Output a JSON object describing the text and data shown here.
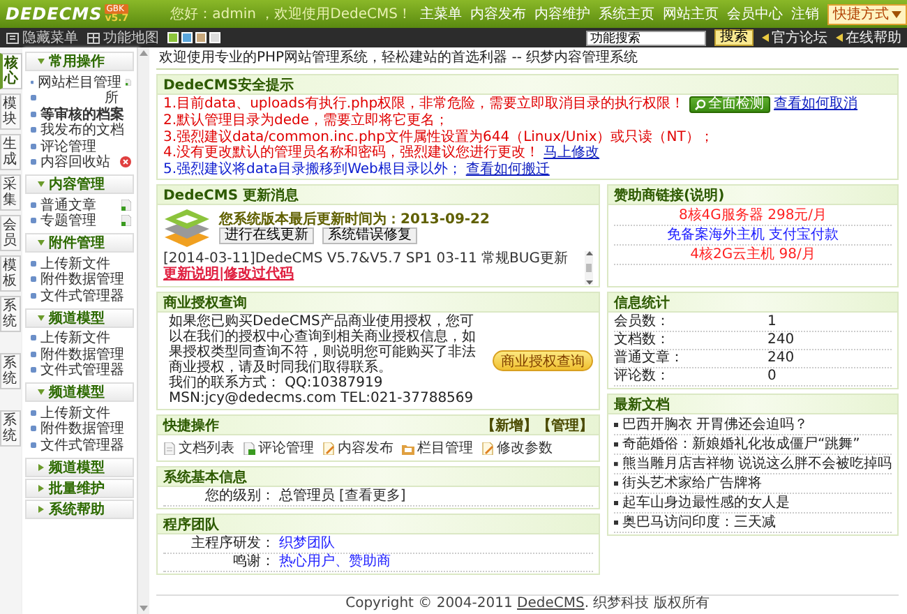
{
  "header": {
    "logo": "DEDECMS",
    "version": "v5.7",
    "edition": "GBK",
    "greeting": "您好：admin ，欢迎使用DedeCMS！",
    "nav": [
      "主菜单",
      "内容发布",
      "内容维护",
      "系统主页",
      "网站主页",
      "会员中心",
      "注销"
    ],
    "shortcut": "快捷方式"
  },
  "toolbar": {
    "buttons": [
      "隐藏菜单",
      "功能地图"
    ],
    "swatches": [
      {
        "color": "#8cc43c"
      },
      {
        "color": "#5aa6dc"
      },
      {
        "color": "#c8a87c"
      },
      {
        "color": "#dcdcdc"
      }
    ],
    "search": {
      "value": "功能搜索",
      "button": "搜索"
    },
    "links": [
      "官方论坛",
      "在线帮助"
    ]
  },
  "side_tabs": [
    {
      "label": "核心",
      "selected": true
    },
    {
      "label": "模块",
      "selected": false
    },
    {
      "label": "生成",
      "selected": false
    },
    {
      "label": "采集",
      "selected": false
    },
    {
      "label": "会员",
      "selected": false
    },
    {
      "label": "模板",
      "selected": false
    },
    {
      "label": "系统",
      "selected": false
    },
    {
      "label": "系统",
      "selected": false
    },
    {
      "label": "系统",
      "selected": false
    }
  ],
  "menu": [
    {
      "title": "常用操作",
      "expanded": true,
      "items": [
        {
          "label": "网站栏目管理",
          "kind": "add"
        },
        {
          "label": "所",
          "kind": "offset"
        },
        {
          "label": "等审核的档案",
          "kind": "bold"
        },
        {
          "label": "我发布的文档",
          "kind": "plain"
        },
        {
          "label": "评论管理",
          "kind": "plain"
        },
        {
          "label": "内容回收站",
          "kind": "delete"
        }
      ]
    },
    {
      "title": "内容管理",
      "expanded": true,
      "items": [
        {
          "label": "普通文章",
          "kind": "add"
        },
        {
          "label": "专题管理",
          "kind": "add"
        }
      ]
    },
    {
      "title": "附件管理",
      "expanded": true,
      "items": [
        {
          "label": "上传新文件",
          "kind": "plain"
        },
        {
          "label": "附件数据管理",
          "kind": "plain"
        },
        {
          "label": "文件式管理器",
          "kind": "plain"
        }
      ]
    },
    {
      "title": "频道模型",
      "expanded": true,
      "items": [
        {
          "label": "上传新文件",
          "kind": "plain"
        },
        {
          "label": "附件数据管理",
          "kind": "plain"
        },
        {
          "label": "文件式管理器",
          "kind": "plain"
        }
      ]
    },
    {
      "title": "频道模型",
      "expanded": true,
      "items": [
        {
          "label": "上传新文件",
          "kind": "plain"
        },
        {
          "label": "附件数据管理",
          "kind": "plain"
        },
        {
          "label": "文件式管理器",
          "kind": "plain"
        }
      ]
    },
    {
      "title": "频道模型",
      "expanded": false
    },
    {
      "title": "批量维护",
      "expanded": false
    },
    {
      "title": "系统帮助",
      "expanded": false
    }
  ],
  "welcome": "欢迎使用专业的PHP网站管理系统，轻松建站的首选利器 -- 织梦内容管理系统",
  "security": {
    "title": "DedeCMS安全提示",
    "items": [
      {
        "text": "1.目前data、uploads有执行.php权限，非常危险，需要立即取消目录的执行权限！",
        "kind": "warning",
        "button": "全面检测",
        "link": "查看如何取消"
      },
      {
        "text": "2.默认管理目录为dede，需要立即将它更名；",
        "kind": "warning"
      },
      {
        "text": "3.强烈建议data/common.inc.php文件属性设置为644（Linux/Unix）或只读（NT）；",
        "kind": "warning"
      },
      {
        "text": "4.没有更改默认的管理员名称和密码，强烈建议您进行更改！",
        "kind": "warning",
        "link": "马上修改"
      },
      {
        "text": "5.强烈建议将data目录搬移到Web根目录以外；",
        "kind": "info",
        "link": "查看如何搬迁"
      }
    ]
  },
  "update": {
    "title": "DedeCMS 更新消息",
    "note": "您系统版本最后更新时间为：2013-09-22",
    "buttons": [
      "进行在线更新",
      "系统错误修复"
    ],
    "news": {
      "text": "[2014-03-11]DedeCMS V5.7&V5.7 SP1 03-11 常规BUG更新",
      "link": "更新说明|修改过代码"
    }
  },
  "license": {
    "title": "商业授权查询",
    "paragraph": "如果您已购买DedeCMS产品商业使用授权，您可以在我们的授权中心查询到相关商业授权信息，如果授权类型同查询不符，则说明您可能购买了非法商业授权，请及时同我们取得联系。",
    "contact": "我们的联系方式： QQ:10387919 MSN:jcy@dedecms.com TEL:021-37788569",
    "button": "商业授权查询"
  },
  "shortcuts": {
    "title": "快捷操作",
    "actions": [
      "【新增】",
      "【管理】"
    ],
    "items": [
      {
        "label": "文档列表",
        "kind": "document"
      },
      {
        "label": "评论管理",
        "kind": "comment"
      },
      {
        "label": "内容发布",
        "kind": "edit"
      },
      {
        "label": "栏目管理",
        "kind": "folder"
      },
      {
        "label": "修改参数",
        "kind": "edit"
      }
    ]
  },
  "system_info": {
    "title": "系统基本信息",
    "rows": [
      {
        "label": "您的级别：",
        "value": "总管理员",
        "link": "[查看更多]"
      }
    ]
  },
  "team": {
    "title": "程序团队",
    "rows": [
      {
        "label": "主程序研发：",
        "link": "织梦团队"
      },
      {
        "label": "鸣谢：",
        "link": "热心用户、赞助商"
      }
    ]
  },
  "sponsors": {
    "title": "赞助商链接(说明)",
    "links": [
      {
        "text": "8核4G服务器 298元/月",
        "color": "#ff2020"
      },
      {
        "text": "免备案海外主机 支付宝付款",
        "color": "#2020ff"
      },
      {
        "text": "4核2G云主机 98/月",
        "color": "#ff2020"
      }
    ]
  },
  "stats": {
    "title": "信息统计",
    "rows": [
      {
        "label": "会员数：",
        "value": "1"
      },
      {
        "label": "文档数：",
        "value": "240"
      },
      {
        "label": "普通文章：",
        "value": "240"
      },
      {
        "label": "评论数：",
        "value": "0"
      }
    ]
  },
  "latest": {
    "title": "最新文档",
    "items": [
      "巴西开胸衣 开胃佛还会迫吗？",
      "奇葩婚俗：新娘婚礼化妆成僵尸“跳舞”",
      "熊当雕月店吉祥物 说说这么胖不会被吃掉吗",
      "街头艺术家给广告牌将",
      "起车山身边最性感的女人是",
      "奥巴马访问印度：三天减"
    ]
  },
  "footer": {
    "text": "Copyright © 2004-2011 ",
    "link": "DedeCMS",
    "suffix": ". 织梦科技 版权所有"
  }
}
